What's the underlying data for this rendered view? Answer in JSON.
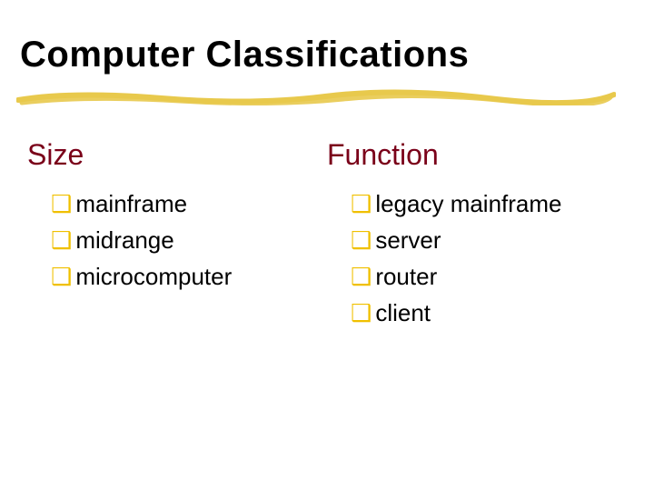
{
  "title": "Computer Classifications",
  "bullet_glyph": "❑",
  "columns": {
    "size": {
      "heading": "Size",
      "items": [
        "mainframe",
        "midrange",
        "microcomputer"
      ]
    },
    "function": {
      "heading": "Function",
      "items": [
        "legacy mainframe",
        "server",
        "router",
        "client"
      ]
    }
  },
  "colors": {
    "heading": "#7a0019",
    "bullet": "#f0c000",
    "underline": "#e8c94c",
    "title": "#000000"
  }
}
